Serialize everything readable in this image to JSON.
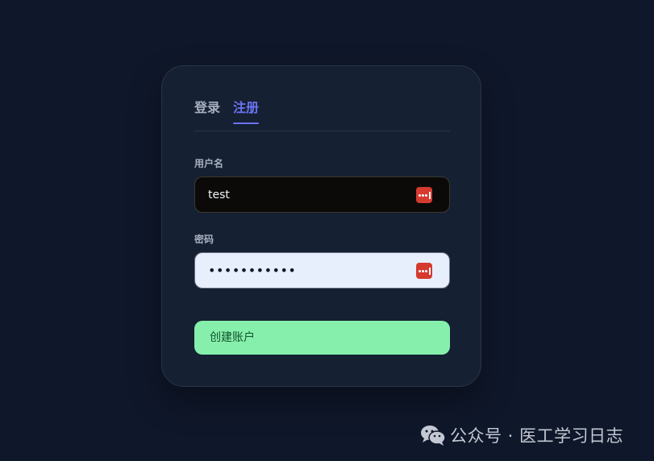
{
  "tabs": {
    "login": "登录",
    "register": "注册",
    "active": "register"
  },
  "form": {
    "username_label": "用户名",
    "username_value": "test",
    "password_label": "密码",
    "password_value": "password123",
    "submit_label": "创建账户"
  },
  "icons": {
    "field_icon": "password-manager-key-icon",
    "watermark_icon": "wechat-icon"
  },
  "colors": {
    "background": "#0f172a",
    "card": "#152033",
    "accent": "#6b73f0",
    "submit": "#86efac",
    "key_icon": "#d63a2f"
  },
  "watermark": {
    "text": "公众号 · 医工学习日志"
  }
}
